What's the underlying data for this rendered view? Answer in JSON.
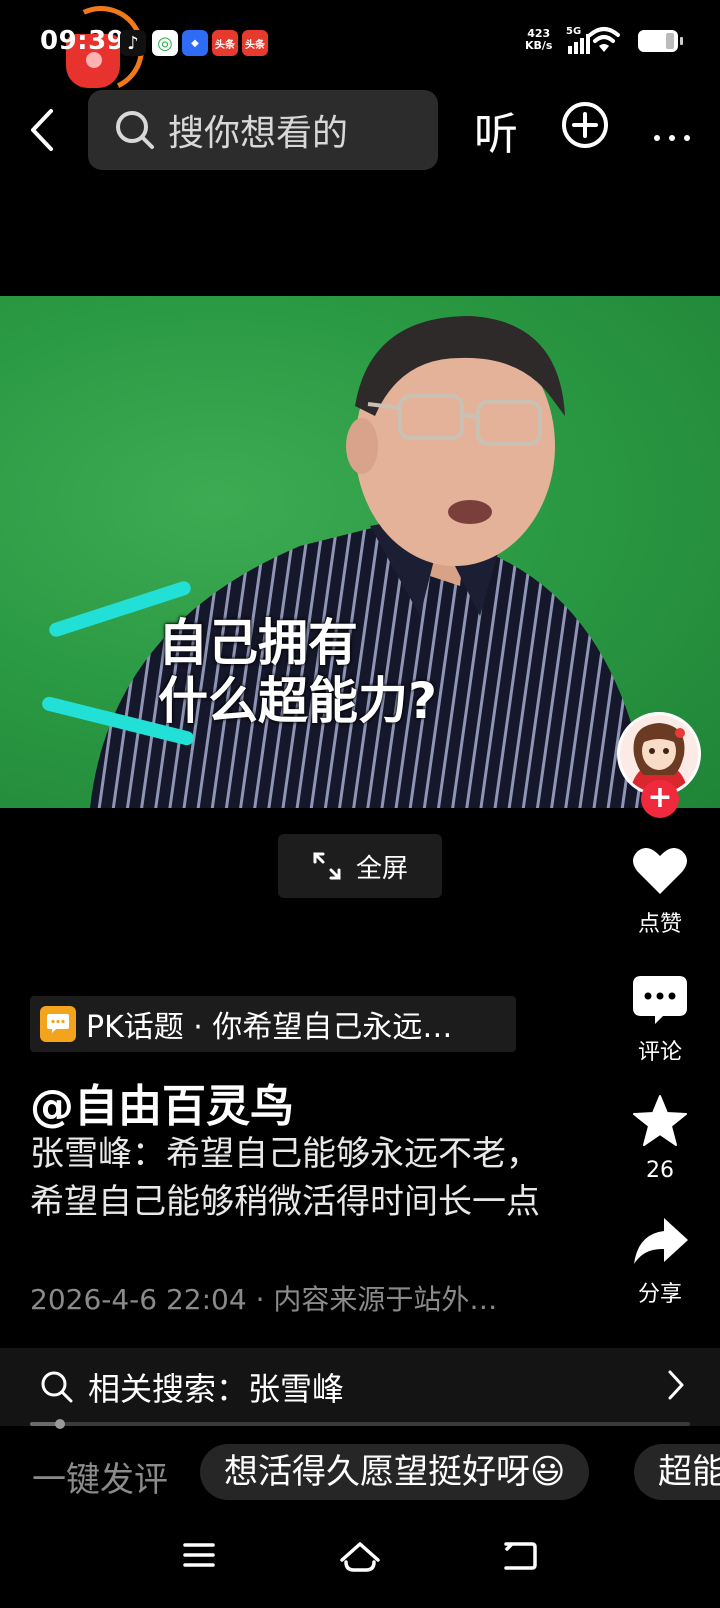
{
  "status_bar": {
    "time": "09:39",
    "net_speed_value": "423",
    "net_speed_unit": "KB/s",
    "signal_label": "5G",
    "notification_icons": [
      "tiktok-icon",
      "green-app-icon",
      "blue-app-icon",
      "toutiao-icon",
      "toutiao-icon"
    ],
    "notif_toutiao_text": "头条"
  },
  "top_nav": {
    "search_placeholder": "搜你想看的",
    "listen_label": "听"
  },
  "video": {
    "caption_line1": "自己拥有",
    "caption_line2": "什么超能力?",
    "fullscreen_label": "全屏"
  },
  "actions": {
    "like_label": "点赞",
    "comment_label": "评论",
    "favorite_count": "26",
    "share_label": "分享"
  },
  "post": {
    "topic": "PK话题 · 你希望自己永远…",
    "author": "@自由百灵鸟",
    "description": "张雪峰：希望自己能够永远不老，希望自己能够稍微活得时间长一点",
    "meta": "2026-4-6 22:04 · 内容来源于站外…"
  },
  "related_search": {
    "label": "相关搜索：张雪峰",
    "progress": 0.045
  },
  "quick_comment": {
    "label": "一键发评",
    "chips": [
      "想活得久愿望挺好呀😃",
      "超能"
    ]
  },
  "colors": {
    "accent_red": "#f02a3c",
    "topic_icon": "#f4a31c",
    "video_green": "#2b9a44",
    "stripe_cyan": "#22e0d6"
  }
}
